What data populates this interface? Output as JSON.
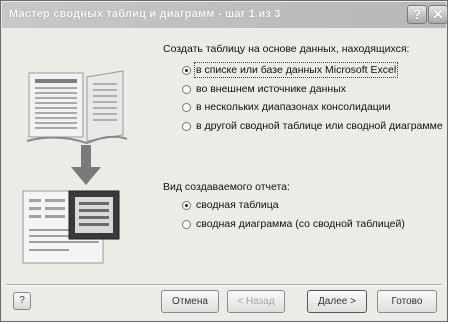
{
  "window": {
    "title": "Мастер сводных таблиц и диаграмм - шаг 1 из 3",
    "help_glyph": "?",
    "close_glyph": "✕"
  },
  "source_section": {
    "heading": "Создать таблицу на основе данных, находящихся:",
    "options": [
      {
        "label": "в списке или базе данных Microsoft Excel",
        "selected": true
      },
      {
        "label": "во внешнем источнике данных",
        "selected": false
      },
      {
        "label": "в нескольких диапазонах консолидации",
        "selected": false
      },
      {
        "label": "в другой сводной таблице или сводной диаграмме",
        "selected": false
      }
    ]
  },
  "report_section": {
    "heading": "Вид создаваемого отчета:",
    "options": [
      {
        "label": "сводная таблица",
        "selected": true
      },
      {
        "label": "сводная диаграмма (со сводной таблицей)",
        "selected": false
      }
    ]
  },
  "footer": {
    "help_icon_glyph": "?",
    "cancel_label": "Отмена",
    "back_label": "< Назад",
    "next_label": "Далее >",
    "finish_label": "Готово"
  },
  "colors": {
    "window_bg": "#ecebe6",
    "titlebar": "#c4c4c4",
    "arrow": "#7a7a7a"
  },
  "icons": [
    "help-icon",
    "close-icon",
    "wizard-illustration",
    "radio-icon"
  ]
}
